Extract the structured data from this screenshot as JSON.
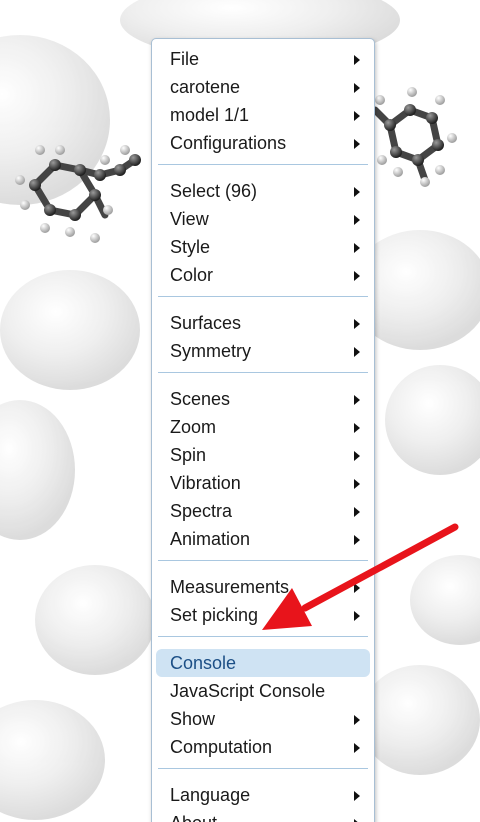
{
  "colors": {
    "menu_border": "#a8bfd4",
    "separator": "#a9c7e0",
    "highlight_bg": "#cfe3f3",
    "highlight_text": "#1c4f86",
    "annotation_arrow": "#e8141b"
  },
  "menu": {
    "groups": [
      {
        "items": [
          {
            "label": "File",
            "submenu": true
          },
          {
            "label": "carotene",
            "submenu": true
          },
          {
            "label": "model 1/1",
            "submenu": true
          },
          {
            "label": "Configurations",
            "submenu": true
          }
        ]
      },
      {
        "items": [
          {
            "label": "Select (96)",
            "submenu": true
          },
          {
            "label": "View",
            "submenu": true
          },
          {
            "label": "Style",
            "submenu": true
          },
          {
            "label": "Color",
            "submenu": true
          }
        ]
      },
      {
        "items": [
          {
            "label": "Surfaces",
            "submenu": true
          },
          {
            "label": "Symmetry",
            "submenu": true
          }
        ]
      },
      {
        "items": [
          {
            "label": "Scenes",
            "submenu": true
          },
          {
            "label": "Zoom",
            "submenu": true
          },
          {
            "label": "Spin",
            "submenu": true
          },
          {
            "label": "Vibration",
            "submenu": true
          },
          {
            "label": "Spectra",
            "submenu": true
          },
          {
            "label": "Animation",
            "submenu": true
          }
        ]
      },
      {
        "items": [
          {
            "label": "Measurements",
            "submenu": true
          },
          {
            "label": "Set picking",
            "submenu": true
          }
        ]
      },
      {
        "items": [
          {
            "label": "Console",
            "submenu": false,
            "highlighted": true
          },
          {
            "label": "JavaScript Console",
            "submenu": false
          },
          {
            "label": "Show",
            "submenu": true
          },
          {
            "label": "Computation",
            "submenu": true
          }
        ]
      },
      {
        "items": [
          {
            "label": "Language",
            "submenu": true
          },
          {
            "label": "About...",
            "submenu": true
          }
        ]
      }
    ]
  }
}
